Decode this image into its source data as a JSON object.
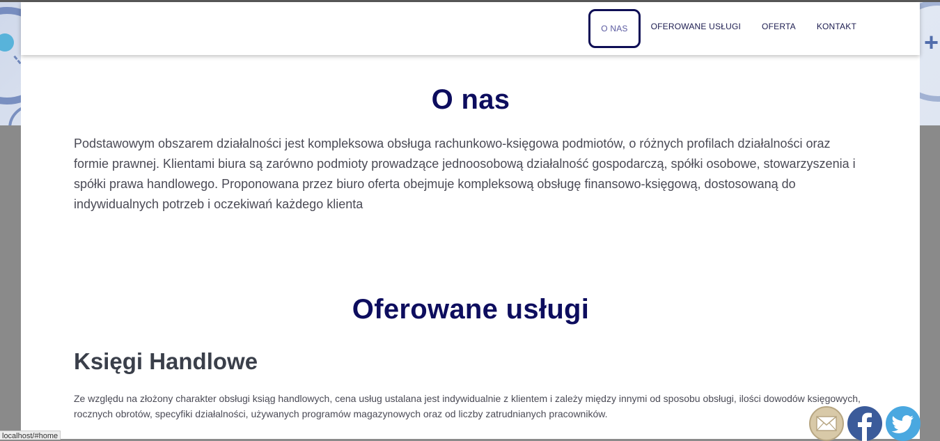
{
  "nav": {
    "items": [
      {
        "label": "O NAS",
        "active": true
      },
      {
        "label": "OFEROWANE USŁUGI",
        "active": false
      },
      {
        "label": "OFERTA",
        "active": false
      },
      {
        "label": "KONTAKT",
        "active": false
      }
    ]
  },
  "about": {
    "title": "O nas",
    "text": "Podstawowym obszarem działalności jest kompleksowa obsługa rachunkowo-księgowa podmiotów, o różnych profilach działalności oraz formie prawnej. Klientami biura są zarówno podmioty prowadzące jednoosobową działalność gospodarczą, spółki osobowe, stowarzyszenia i spółki prawa handlowego. Proponowana przez biuro oferta obejmuje kompleksową obsługę finansowo-księgową, dostosowaną do indywidualnych potrzeb i oczekiwań każdego klienta"
  },
  "services": {
    "title": "Oferowane usługi",
    "ksiegi": {
      "title": "Księgi Handlowe",
      "text": "Ze względu na złożony charakter obsługi ksiąg handlowych, cena usług ustalana jest indywidualnie z klientem i zależy między innymi od sposobu obsługi, ilości dowodów księgowych, rocznych obrotów, specyfiki działalności, używanych programów magazynowych oraz od liczby zatrudnianych pracowników."
    }
  },
  "status_bar": {
    "url": "localhost/#home"
  },
  "social": {
    "icons": [
      "email-icon",
      "facebook-icon",
      "twitter-icon"
    ]
  },
  "colors": {
    "heading": "#0d0d5e",
    "nav_text": "#1b1b4f",
    "facebook": "#3b5b9a",
    "twitter": "#4aa8e0"
  }
}
